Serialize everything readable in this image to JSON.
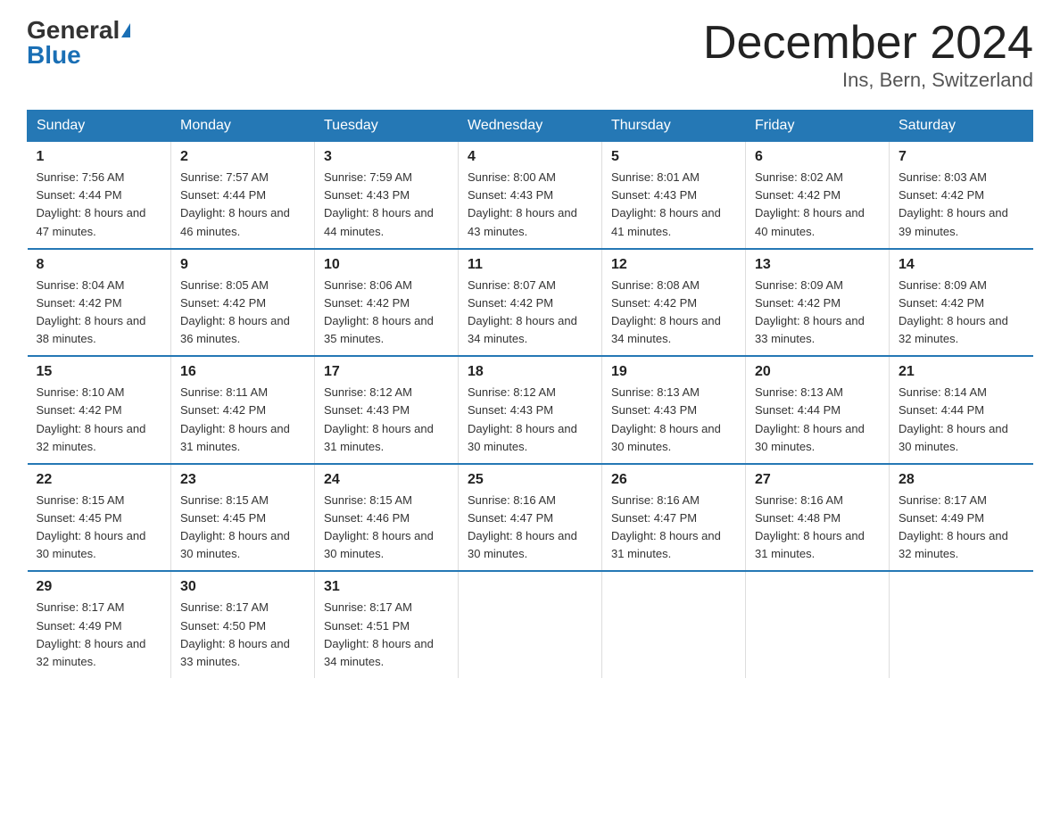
{
  "logo": {
    "general": "General",
    "blue": "Blue"
  },
  "title": "December 2024",
  "location": "Ins, Bern, Switzerland",
  "headers": [
    "Sunday",
    "Monday",
    "Tuesday",
    "Wednesday",
    "Thursday",
    "Friday",
    "Saturday"
  ],
  "weeks": [
    [
      {
        "day": "1",
        "sunrise": "7:56 AM",
        "sunset": "4:44 PM",
        "daylight": "8 hours and 47 minutes."
      },
      {
        "day": "2",
        "sunrise": "7:57 AM",
        "sunset": "4:44 PM",
        "daylight": "8 hours and 46 minutes."
      },
      {
        "day": "3",
        "sunrise": "7:59 AM",
        "sunset": "4:43 PM",
        "daylight": "8 hours and 44 minutes."
      },
      {
        "day": "4",
        "sunrise": "8:00 AM",
        "sunset": "4:43 PM",
        "daylight": "8 hours and 43 minutes."
      },
      {
        "day": "5",
        "sunrise": "8:01 AM",
        "sunset": "4:43 PM",
        "daylight": "8 hours and 41 minutes."
      },
      {
        "day": "6",
        "sunrise": "8:02 AM",
        "sunset": "4:42 PM",
        "daylight": "8 hours and 40 minutes."
      },
      {
        "day": "7",
        "sunrise": "8:03 AM",
        "sunset": "4:42 PM",
        "daylight": "8 hours and 39 minutes."
      }
    ],
    [
      {
        "day": "8",
        "sunrise": "8:04 AM",
        "sunset": "4:42 PM",
        "daylight": "8 hours and 38 minutes."
      },
      {
        "day": "9",
        "sunrise": "8:05 AM",
        "sunset": "4:42 PM",
        "daylight": "8 hours and 36 minutes."
      },
      {
        "day": "10",
        "sunrise": "8:06 AM",
        "sunset": "4:42 PM",
        "daylight": "8 hours and 35 minutes."
      },
      {
        "day": "11",
        "sunrise": "8:07 AM",
        "sunset": "4:42 PM",
        "daylight": "8 hours and 34 minutes."
      },
      {
        "day": "12",
        "sunrise": "8:08 AM",
        "sunset": "4:42 PM",
        "daylight": "8 hours and 34 minutes."
      },
      {
        "day": "13",
        "sunrise": "8:09 AM",
        "sunset": "4:42 PM",
        "daylight": "8 hours and 33 minutes."
      },
      {
        "day": "14",
        "sunrise": "8:09 AM",
        "sunset": "4:42 PM",
        "daylight": "8 hours and 32 minutes."
      }
    ],
    [
      {
        "day": "15",
        "sunrise": "8:10 AM",
        "sunset": "4:42 PM",
        "daylight": "8 hours and 32 minutes."
      },
      {
        "day": "16",
        "sunrise": "8:11 AM",
        "sunset": "4:42 PM",
        "daylight": "8 hours and 31 minutes."
      },
      {
        "day": "17",
        "sunrise": "8:12 AM",
        "sunset": "4:43 PM",
        "daylight": "8 hours and 31 minutes."
      },
      {
        "day": "18",
        "sunrise": "8:12 AM",
        "sunset": "4:43 PM",
        "daylight": "8 hours and 30 minutes."
      },
      {
        "day": "19",
        "sunrise": "8:13 AM",
        "sunset": "4:43 PM",
        "daylight": "8 hours and 30 minutes."
      },
      {
        "day": "20",
        "sunrise": "8:13 AM",
        "sunset": "4:44 PM",
        "daylight": "8 hours and 30 minutes."
      },
      {
        "day": "21",
        "sunrise": "8:14 AM",
        "sunset": "4:44 PM",
        "daylight": "8 hours and 30 minutes."
      }
    ],
    [
      {
        "day": "22",
        "sunrise": "8:15 AM",
        "sunset": "4:45 PM",
        "daylight": "8 hours and 30 minutes."
      },
      {
        "day": "23",
        "sunrise": "8:15 AM",
        "sunset": "4:45 PM",
        "daylight": "8 hours and 30 minutes."
      },
      {
        "day": "24",
        "sunrise": "8:15 AM",
        "sunset": "4:46 PM",
        "daylight": "8 hours and 30 minutes."
      },
      {
        "day": "25",
        "sunrise": "8:16 AM",
        "sunset": "4:47 PM",
        "daylight": "8 hours and 30 minutes."
      },
      {
        "day": "26",
        "sunrise": "8:16 AM",
        "sunset": "4:47 PM",
        "daylight": "8 hours and 31 minutes."
      },
      {
        "day": "27",
        "sunrise": "8:16 AM",
        "sunset": "4:48 PM",
        "daylight": "8 hours and 31 minutes."
      },
      {
        "day": "28",
        "sunrise": "8:17 AM",
        "sunset": "4:49 PM",
        "daylight": "8 hours and 32 minutes."
      }
    ],
    [
      {
        "day": "29",
        "sunrise": "8:17 AM",
        "sunset": "4:49 PM",
        "daylight": "8 hours and 32 minutes."
      },
      {
        "day": "30",
        "sunrise": "8:17 AM",
        "sunset": "4:50 PM",
        "daylight": "8 hours and 33 minutes."
      },
      {
        "day": "31",
        "sunrise": "8:17 AM",
        "sunset": "4:51 PM",
        "daylight": "8 hours and 34 minutes."
      },
      null,
      null,
      null,
      null
    ]
  ],
  "labels": {
    "sunrise": "Sunrise: ",
    "sunset": "Sunset: ",
    "daylight": "Daylight: "
  }
}
